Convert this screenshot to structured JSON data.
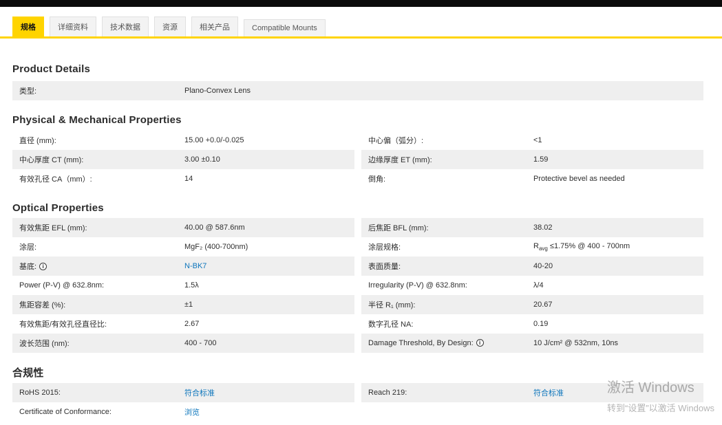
{
  "colors": {
    "accent_yellow": "#ffd400",
    "link_blue": "#0e76bc",
    "row_gray": "#efefef",
    "top_bar": "#0b0b0b"
  },
  "icons": {
    "info_glyph": "i"
  },
  "tabs": [
    {
      "label": "规格",
      "active": true
    },
    {
      "label": "详细资料",
      "active": false
    },
    {
      "label": "技术数据",
      "active": false
    },
    {
      "label": "资源",
      "active": false
    },
    {
      "label": "相关产品",
      "active": false
    },
    {
      "label": "Compatible Mounts",
      "active": false
    }
  ],
  "product_details": {
    "heading": "Product Details",
    "rows": [
      {
        "label": "类型:",
        "value": "Plano-Convex Lens"
      }
    ]
  },
  "physical": {
    "heading": "Physical & Mechanical Properties",
    "left": [
      {
        "label": "直径 (mm):",
        "value": "15.00 +0.0/-0.025"
      },
      {
        "label": "中心厚度 CT (mm):",
        "value": "3.00 ±0.10"
      },
      {
        "label": "有效孔径 CA（mm）:",
        "value": "14"
      }
    ],
    "right": [
      {
        "label": "中心偏（弧分）:",
        "value": "<1"
      },
      {
        "label": "边缘厚度 ET (mm):",
        "value": "1.59"
      },
      {
        "label": "倒角:",
        "value": "Protective bevel as needed"
      }
    ]
  },
  "optical": {
    "heading": "Optical Properties",
    "left": [
      {
        "label": "有效焦距 EFL (mm):",
        "value": "40.00 @ 587.6nm"
      },
      {
        "label": "涂层:",
        "value": "MgF₂ (400-700nm)"
      },
      {
        "label": "基底:",
        "value": "N-BK7"
      },
      {
        "label": "Power (P-V) @ 632.8nm:",
        "value": "1.5λ"
      },
      {
        "label": "焦距容差 (%):",
        "value": "±1"
      },
      {
        "label": "有效焦距/有效孔径直径比:",
        "value": "2.67"
      },
      {
        "label": "波长范围 (nm):",
        "value": "400 - 700"
      }
    ],
    "right": [
      {
        "label": "后焦距 BFL (mm):",
        "value": "38.02"
      },
      {
        "label": "涂层规格:",
        "value_pre": "R",
        "value_sub": "avg",
        "value_post": " ≤1.75% @ 400 - 700nm"
      },
      {
        "label": "表面质量:",
        "value": "40-20"
      },
      {
        "label": "Irregularity (P-V) @ 632.8nm:",
        "value": "λ/4"
      },
      {
        "label": "半径 R₁ (mm):",
        "value": "20.67"
      },
      {
        "label": "数字孔径 NA:",
        "value": "0.19"
      },
      {
        "label": "Damage Threshold, By Design:",
        "value": "10 J/cm² @ 532nm, 10ns"
      }
    ]
  },
  "compliance": {
    "heading": "合规性",
    "left": [
      {
        "label": "RoHS 2015:",
        "value": "符合标准"
      },
      {
        "label": "Certificate of Conformance:",
        "value": "浏览"
      }
    ],
    "right": [
      {
        "label": "Reach 219:",
        "value": "符合标准"
      }
    ]
  },
  "watermark": {
    "line1": "激活 Windows",
    "line2": "转到“设置”以激活 Windows"
  }
}
